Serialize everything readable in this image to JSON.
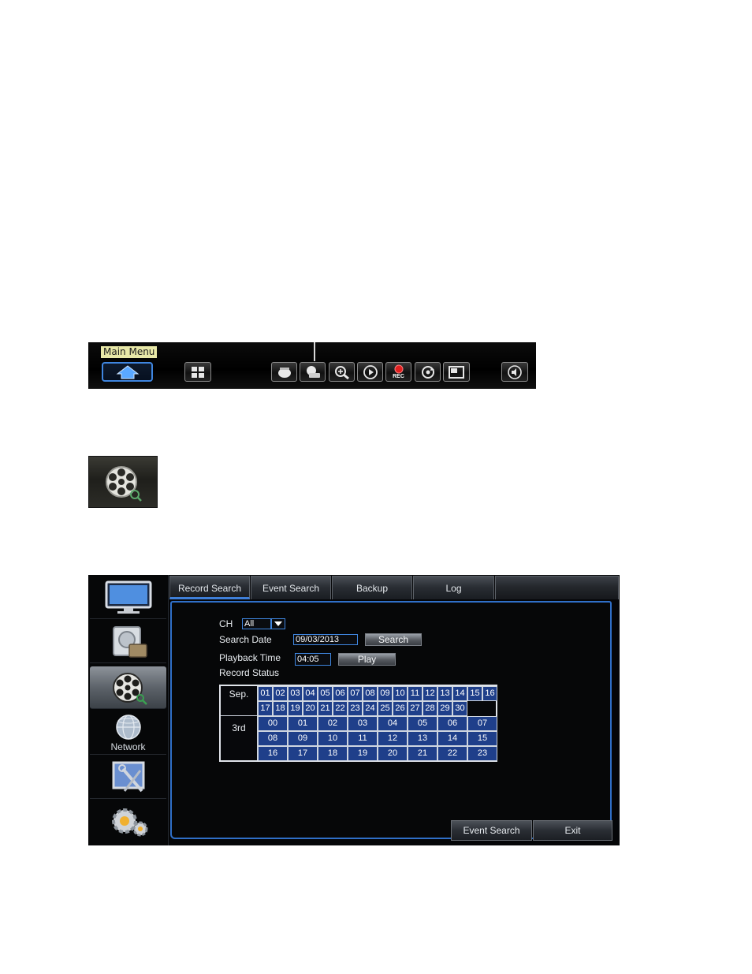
{
  "toolbar": {
    "tooltip": "Main Menu",
    "rec_label": "REC",
    "buttons": [
      {
        "name": "home-button",
        "icon": "home-icon"
      },
      {
        "name": "split-screen-button",
        "icon": "quad-view-icon"
      },
      {
        "name": "ptz-button",
        "icon": "ptz-camera-icon"
      },
      {
        "name": "camera-button",
        "icon": "camera-icon"
      },
      {
        "name": "zoom-button",
        "icon": "zoom-in-icon"
      },
      {
        "name": "play-button",
        "icon": "play-icon"
      },
      {
        "name": "record-button",
        "icon": "record-icon"
      },
      {
        "name": "sequence-button",
        "icon": "cycle-icon"
      },
      {
        "name": "pip-button",
        "icon": "picture-in-picture-icon"
      },
      {
        "name": "volume-button",
        "icon": "speaker-icon"
      }
    ]
  },
  "reel_icon": "film-reel-search-icon",
  "window": {
    "sidebar": [
      {
        "name": "display",
        "icon": "monitor-icon",
        "label": ""
      },
      {
        "name": "record",
        "icon": "hdd-record-icon",
        "label": ""
      },
      {
        "name": "search",
        "icon": "film-reel-search-icon",
        "label": "",
        "active": true
      },
      {
        "name": "network",
        "icon": "globe-icon",
        "label": "Network"
      },
      {
        "name": "device",
        "icon": "device-tools-icon",
        "label": ""
      },
      {
        "name": "system",
        "icon": "gears-icon",
        "label": ""
      }
    ],
    "tabs": [
      {
        "label": "Record Search",
        "active": true
      },
      {
        "label": "Event Search",
        "active": false
      },
      {
        "label": "Backup",
        "active": false
      },
      {
        "label": "Log",
        "active": false
      }
    ],
    "form": {
      "ch_label": "CH",
      "ch_value": "All",
      "search_date_label": "Search Date",
      "search_date_value": "09/03/2013",
      "search_button": "Search",
      "playback_time_label": "Playback Time",
      "playback_time_value": "04:05",
      "play_button": "Play",
      "record_status_label": "Record Status"
    },
    "record_status": {
      "month_label": "Sep.",
      "day_label": "3rd",
      "days": [
        "01",
        "02",
        "03",
        "04",
        "05",
        "06",
        "07",
        "08",
        "09",
        "10",
        "11",
        "12",
        "13",
        "14",
        "15",
        "16",
        "17",
        "18",
        "19",
        "20",
        "21",
        "22",
        "23",
        "24",
        "25",
        "26",
        "27",
        "28",
        "29",
        "30"
      ],
      "hours": [
        "00",
        "01",
        "02",
        "03",
        "04",
        "05",
        "06",
        "07",
        "08",
        "09",
        "10",
        "11",
        "12",
        "13",
        "14",
        "15",
        "16",
        "17",
        "18",
        "19",
        "20",
        "21",
        "22",
        "23"
      ]
    },
    "footer": {
      "event_search_button": "Event Search",
      "exit_button": "Exit"
    },
    "colors": {
      "accent": "#3f86e0",
      "cell_fill": "#1f3f8a"
    }
  }
}
